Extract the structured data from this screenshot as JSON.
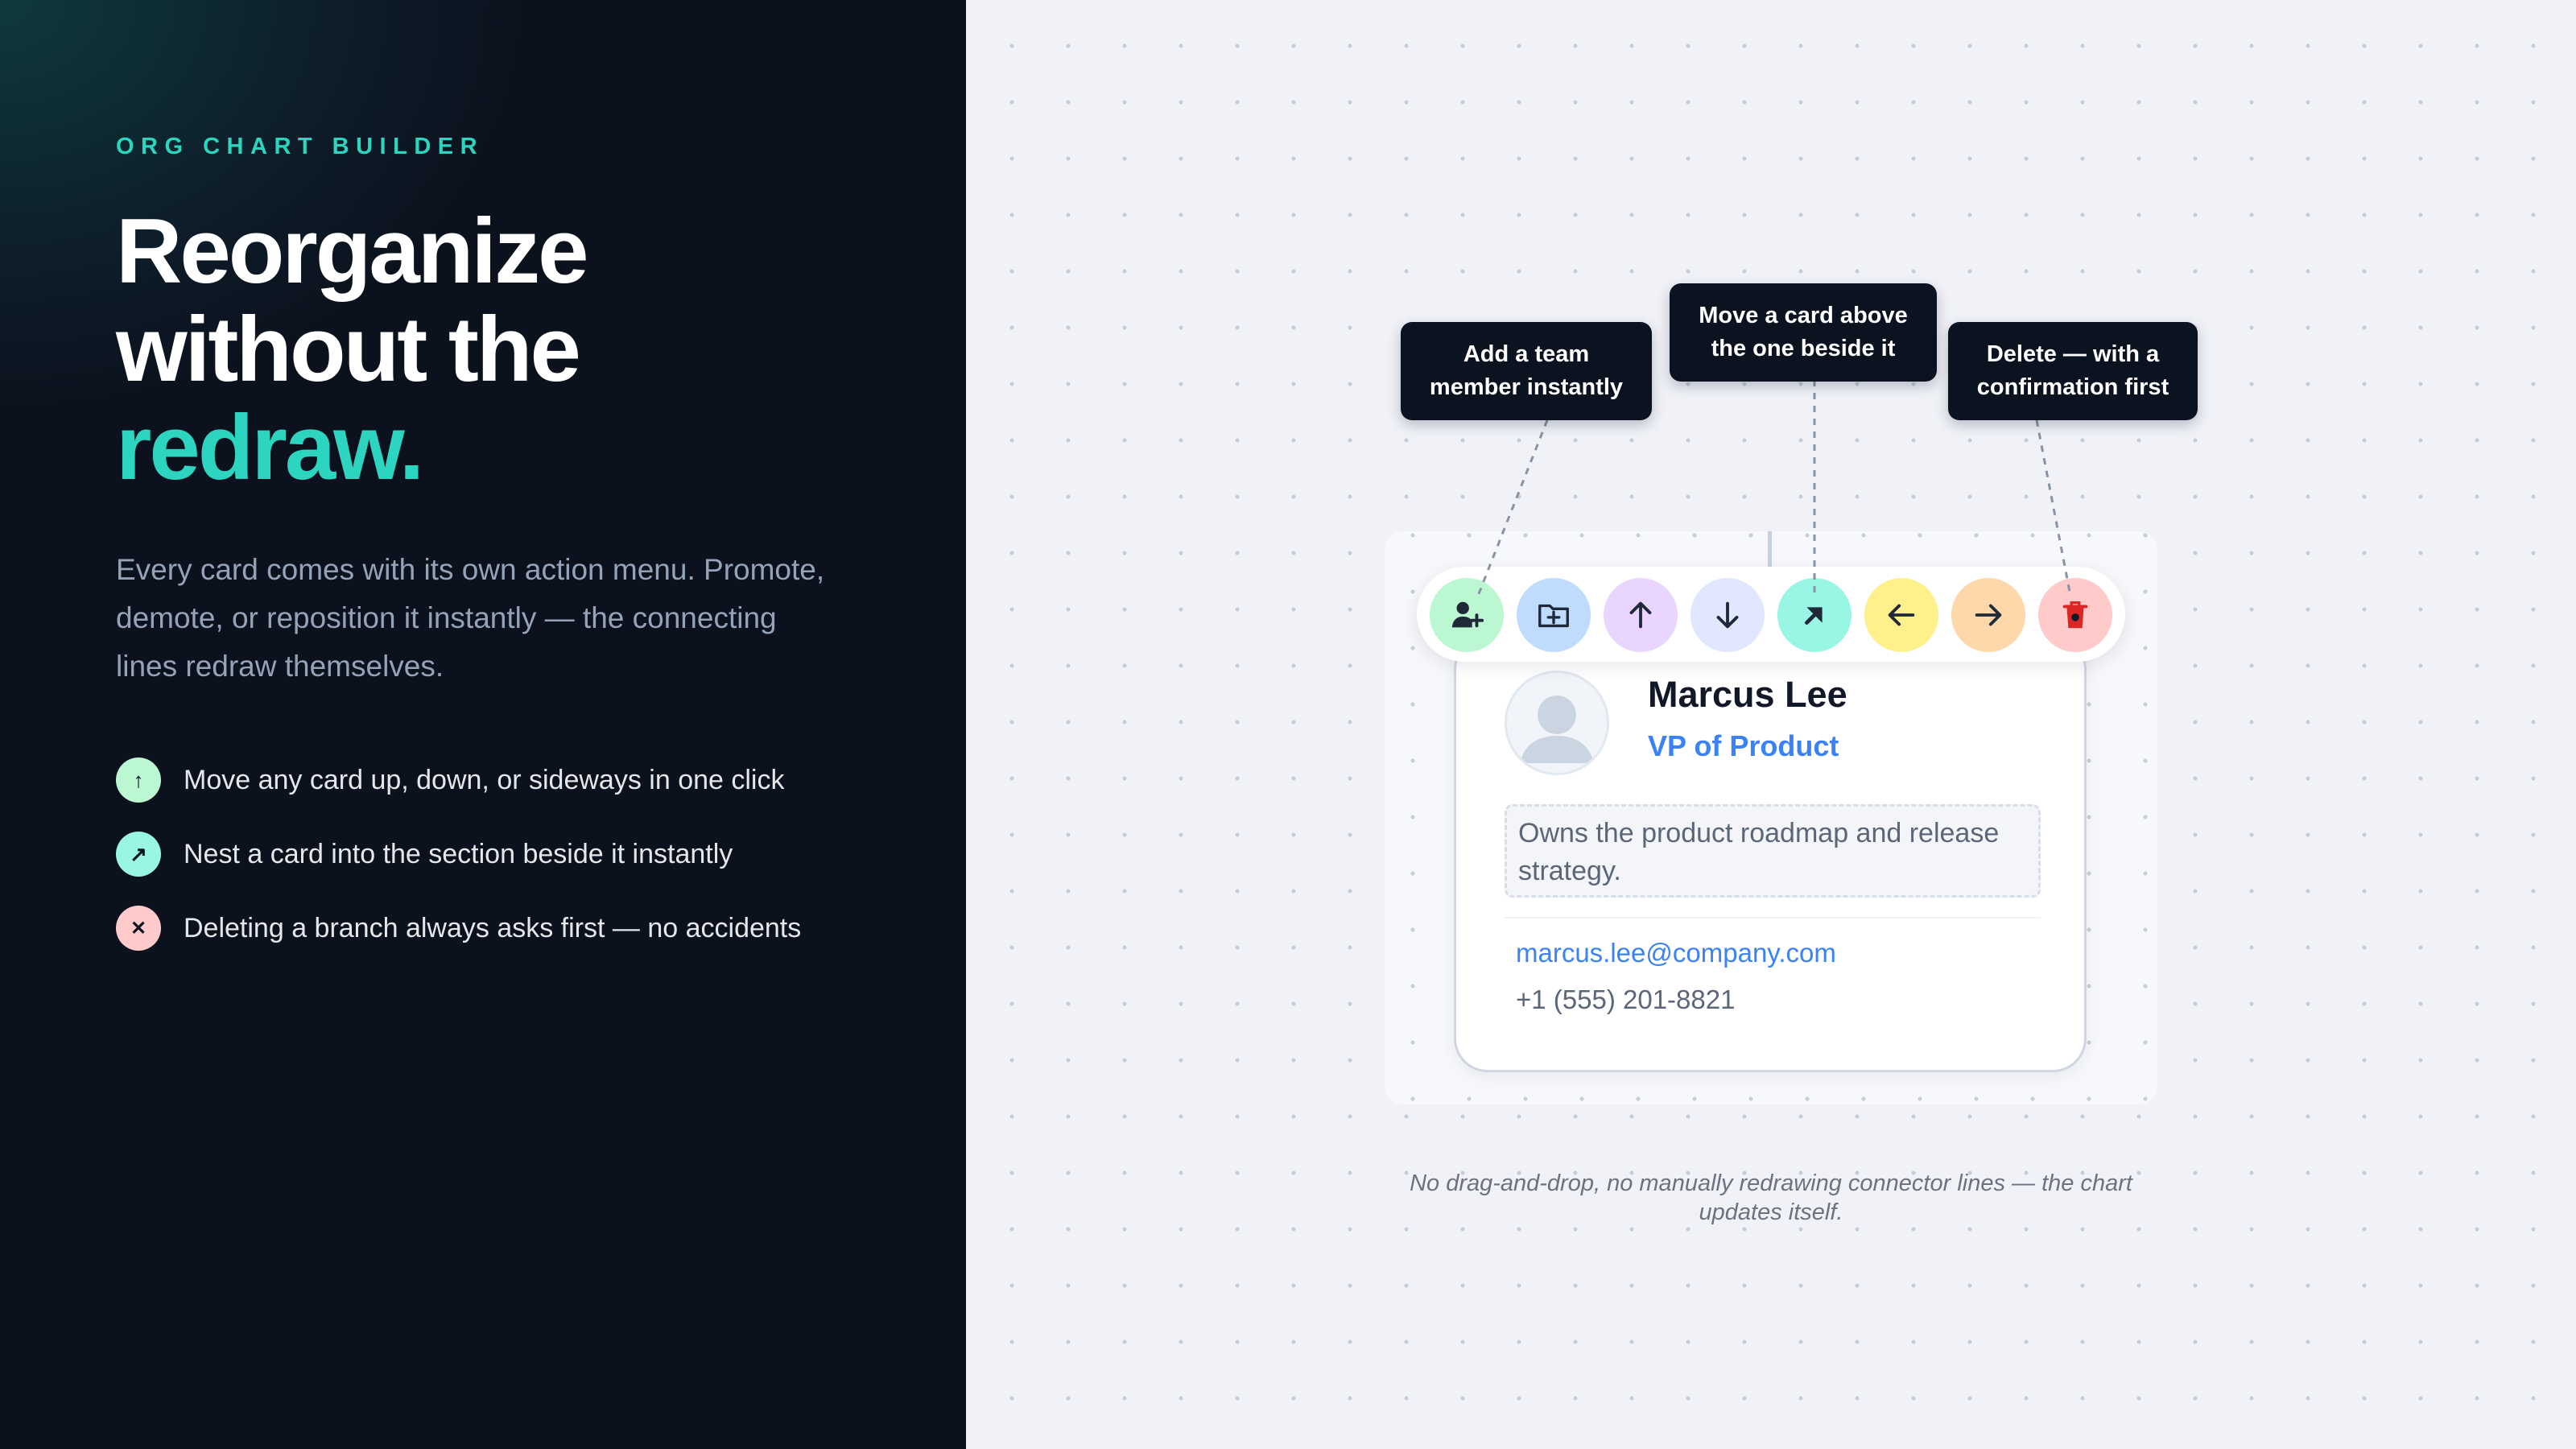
{
  "left": {
    "eyebrow": "ORG CHART BUILDER",
    "headline": {
      "line1": "Reorganize",
      "line2": "without the",
      "accent": "redraw."
    },
    "lede": "Every card comes with its own action menu. Promote, demote, or reposition it instantly — the connecting lines redraw themselves.",
    "features": [
      {
        "icon": "↑",
        "icon_name": "arrow-up-icon",
        "color": "#bbf7d0",
        "text": "Move any card up, down, or sideways in one click"
      },
      {
        "icon": "↗",
        "icon_name": "arrow-up-right-icon",
        "color": "#99f6e4",
        "text": "Nest a card into the section beside it instantly"
      },
      {
        "icon": "✕",
        "icon_name": "x-icon",
        "color": "#fecaca",
        "text": "Deleting a branch always asks first — no accidents"
      }
    ]
  },
  "toolbar": {
    "buttons": [
      {
        "icon": "user-plus-icon",
        "bg": "#bbf7d0"
      },
      {
        "icon": "folder-plus-icon",
        "bg": "#bfdbfe"
      },
      {
        "icon": "arrow-up-icon",
        "bg": "#e9d5ff"
      },
      {
        "icon": "arrow-down-icon",
        "bg": "#e0e7ff"
      },
      {
        "icon": "nest-icon",
        "bg": "#99f6e4"
      },
      {
        "icon": "arrow-left-icon",
        "bg": "#fef08a"
      },
      {
        "icon": "arrow-right-icon",
        "bg": "#fed7aa"
      },
      {
        "icon": "trash-icon",
        "bg": "#fecaca"
      }
    ]
  },
  "tooltips": {
    "add": {
      "line1": "Add a team",
      "line2": "member instantly"
    },
    "move": {
      "line1": "Move a card above",
      "line2": "the one beside it"
    },
    "delete": {
      "line1": "Delete — with a",
      "line2": "confirmation first"
    }
  },
  "card": {
    "name": "Marcus Lee",
    "role": "VP of Product",
    "description": "Owns the product roadmap and release strategy.",
    "email": "marcus.lee@company.com",
    "phone": "+1 (555) 201-8821"
  },
  "caption": "No drag-and-drop, no manually redrawing connector lines — the chart updates itself.",
  "colors": {
    "accent": "#2dd4bf",
    "link": "#3b82f6",
    "dark": "#0b1220"
  }
}
